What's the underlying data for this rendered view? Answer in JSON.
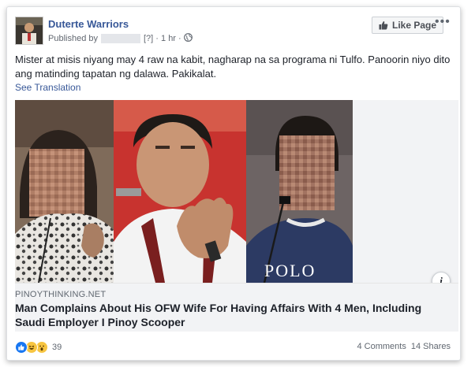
{
  "post": {
    "page_name": "Duterte Warriors",
    "published_by_label": "Published by",
    "question_mark": "[?]",
    "time": "1 hr",
    "text": "Mister at misis niyang may 4 raw na kabit, nagharap na sa programa ni Tulfo. Panoorin niyo dito ang matinding tapatan ng dalawa. Pakikalat.",
    "see_translation": "See Translation"
  },
  "header": {
    "like_page_label": "Like Page",
    "more_label": "•••"
  },
  "link": {
    "domain": "PINOYTHINKING.NET",
    "title": "Man Complains About His OFW Wife For Having Affairs With 4 Men, Including Saudi Employer I Pinoy Scooper",
    "info_label": "i"
  },
  "footer": {
    "reactions": [
      "like-reaction-icon",
      "haha-reaction-icon",
      "wow-reaction-icon"
    ],
    "reaction_count": "39",
    "comments": "4 Comments",
    "shares": "14 Shares"
  },
  "colors": {
    "link_blue": "#385898",
    "like_blue": "#1877f2",
    "reaction_yellow": "#f7c541"
  }
}
